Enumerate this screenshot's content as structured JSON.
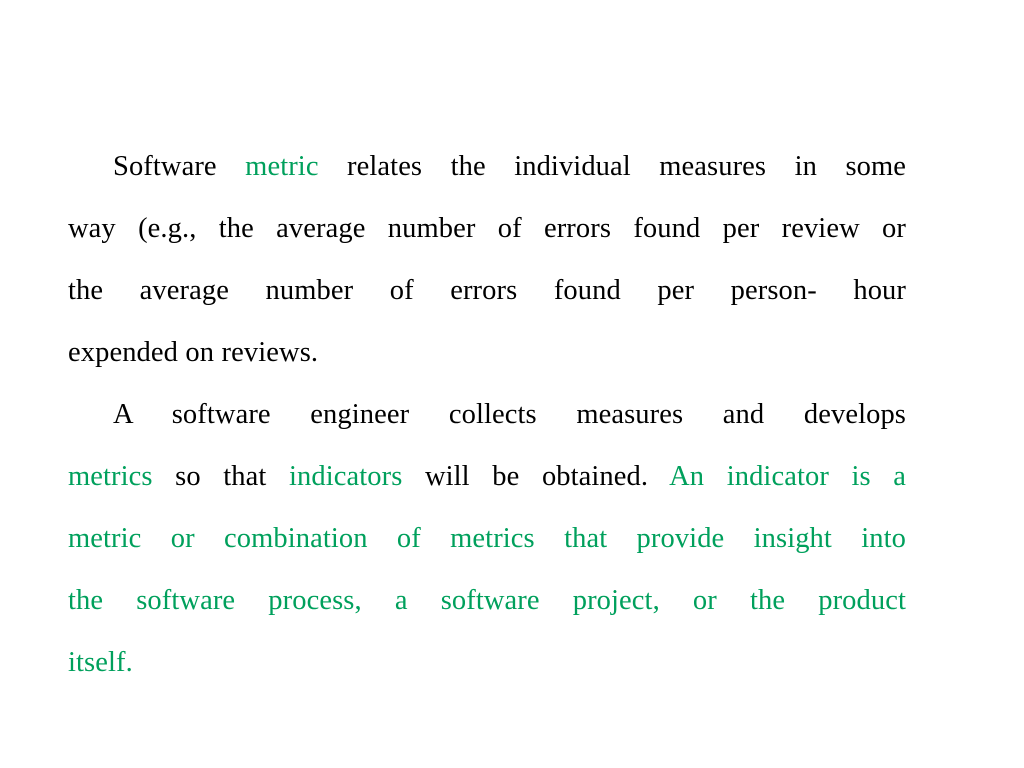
{
  "slide": {
    "background_color": "#ffffff",
    "text_color": "#000000",
    "accent_color": "#00a05c",
    "paragraphs": [
      {
        "id": "paragraph-metric-definition",
        "lines": [
          {
            "id": "line-1",
            "indent": true,
            "justified": true,
            "runs": [
              {
                "text": "Software ",
                "color": "black"
              },
              {
                "text": "metric",
                "color": "green"
              },
              {
                "text": " relates the individual measures in some",
                "color": "black"
              }
            ],
            "plain": "Software metric relates the individual measures in some"
          },
          {
            "id": "line-2",
            "indent": false,
            "justified": true,
            "runs": [
              {
                "text": "way (e.g., the average number of errors found per review or",
                "color": "black"
              }
            ],
            "plain": "way (e.g., the average number of errors found per review or"
          },
          {
            "id": "line-3",
            "indent": false,
            "justified": true,
            "runs": [
              {
                "text": "the average number of errors found per person- hour",
                "color": "black"
              }
            ],
            "plain": "the average number of errors found per person- hour"
          },
          {
            "id": "line-4",
            "indent": false,
            "justified": false,
            "runs": [
              {
                "text": "expended on reviews.",
                "color": "black"
              }
            ],
            "plain": "expended on reviews."
          }
        ]
      },
      {
        "id": "paragraph-indicator-definition",
        "lines": [
          {
            "id": "line-5",
            "indent": true,
            "justified": true,
            "runs": [
              {
                "text": "A software engineer collects measures and develops",
                "color": "black"
              }
            ],
            "plain": "A software engineer collects measures and develops"
          },
          {
            "id": "line-6",
            "indent": false,
            "justified": true,
            "runs": [
              {
                "text": "metrics",
                "color": "green"
              },
              {
                "text": " so that ",
                "color": "black"
              },
              {
                "text": "indicators",
                "color": "green"
              },
              {
                "text": " will be obtained. ",
                "color": "black"
              },
              {
                "text": "An indicator is a",
                "color": "green"
              }
            ],
            "plain": "metrics so that indicators will be obtained. An indicator is a"
          },
          {
            "id": "line-7",
            "indent": false,
            "justified": true,
            "runs": [
              {
                "text": "metric or combination of metrics that provide insight into",
                "color": "green"
              }
            ],
            "plain": "metric or combination of metrics that provide insight into"
          },
          {
            "id": "line-8",
            "indent": false,
            "justified": true,
            "runs": [
              {
                "text": "the software process, a software project, or the product",
                "color": "green"
              }
            ],
            "plain": "the software process, a software project, or the product"
          },
          {
            "id": "line-9",
            "indent": false,
            "justified": false,
            "runs": [
              {
                "text": "itself.",
                "color": "green"
              }
            ],
            "plain": "itself."
          }
        ]
      }
    ]
  }
}
